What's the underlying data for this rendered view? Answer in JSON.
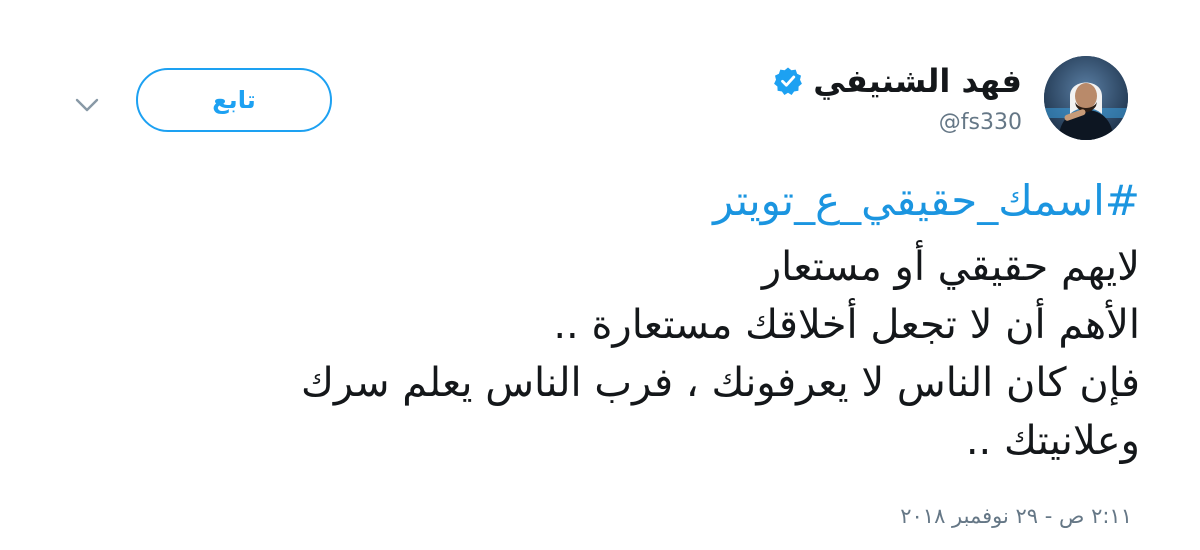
{
  "tweet": {
    "follow_label": "تابع",
    "user": {
      "display_name": "فهد الشنيفي",
      "handle": "@fs330",
      "verified": true
    },
    "hashtag": "#اسمك_حقيقي_ع_تويتر",
    "lines": [
      "لايهم حقيقي أو مستعار",
      "الأهم أن لا تجعل أخلاقك مستعارة ..",
      "فإن كان الناس لا يعرفونك ، فرب الناس يعلم سرك",
      "وعلانيتك .."
    ],
    "timestamp": "٢:١١ ص - ٢٩ نوفمبر ٢٠١٨"
  },
  "colors": {
    "accent": "#1da1f2",
    "hashtag": "#1b95e0",
    "muted": "#657786",
    "text": "#14171a"
  },
  "icons": {
    "menu": "chevron-down-icon",
    "verified": "verified-badge-icon"
  }
}
